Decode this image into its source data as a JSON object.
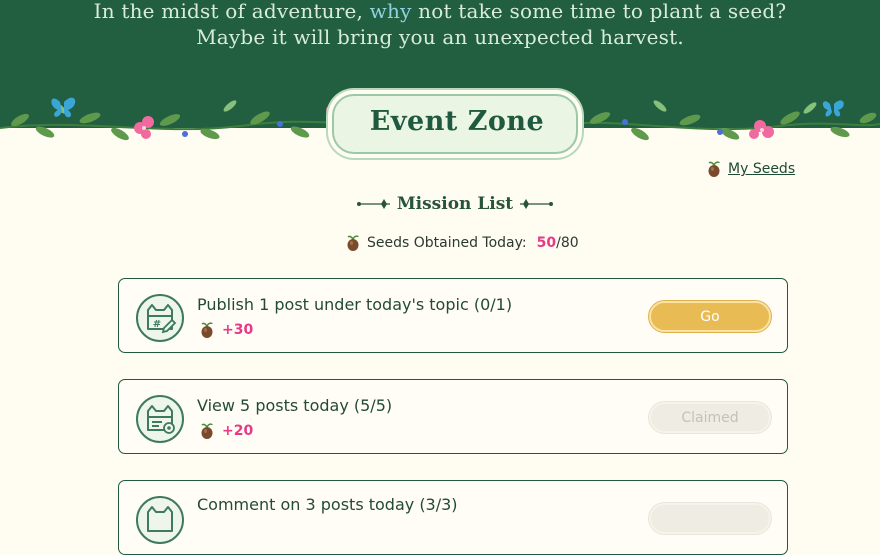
{
  "banner": {
    "line1_prefix": "In the midst of adventure, ",
    "line1_accent": "why",
    "line1_suffix": " not take some time to plant a seed?",
    "line2": "Maybe it will bring you an unexpected harvest."
  },
  "event": {
    "title": "Event Zone"
  },
  "my_seeds": {
    "label": "My Seeds"
  },
  "mission_list": {
    "title": "Mission List",
    "seeds_today_label": "Seeds Obtained Today:",
    "seeds_today_count": "50",
    "seeds_today_max": "/80"
  },
  "tasks": [
    {
      "title": "Publish 1 post under today's topic (0/1)",
      "points": "+30",
      "button": "Go",
      "state": "active",
      "icon": "hashtag-post-icon"
    },
    {
      "title": "View 5 posts today (5/5)",
      "points": "+20",
      "button": "Claimed",
      "state": "claimed",
      "icon": "view-post-icon"
    },
    {
      "title": "Comment on 3 posts today (3/3)",
      "points": "",
      "button": "",
      "state": "claimed",
      "icon": "comment-post-icon"
    }
  ],
  "colors": {
    "banner_green": "#225f41",
    "accent_pink": "#e63a86",
    "go_button": "#e9bb55",
    "claimed_button": "#efede3",
    "card_border": "#1f5a40"
  }
}
